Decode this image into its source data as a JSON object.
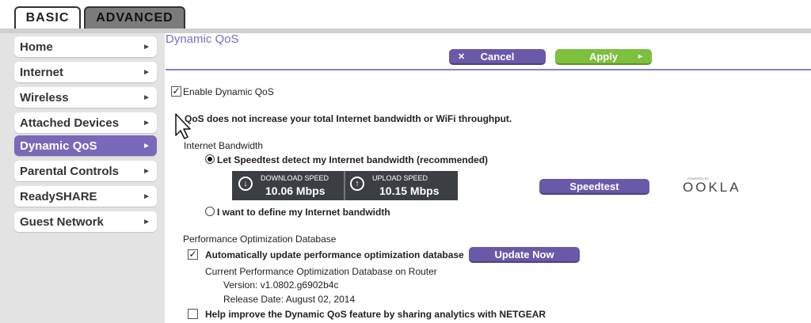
{
  "tabs": {
    "basic": "BASIC",
    "advanced": "ADVANCED"
  },
  "sidebar": {
    "items": [
      {
        "label": "Home"
      },
      {
        "label": "Internet"
      },
      {
        "label": "Wireless"
      },
      {
        "label": "Attached Devices"
      },
      {
        "label": "Dynamic QoS",
        "active": true
      },
      {
        "label": "Parental Controls"
      },
      {
        "label": "ReadySHARE"
      },
      {
        "label": "Guest Network"
      }
    ]
  },
  "page": {
    "title": "Dynamic QoS"
  },
  "actions": {
    "cancel": "Cancel",
    "apply": "Apply"
  },
  "qos": {
    "enable_label": "Enable Dynamic QoS",
    "enable_checked": true,
    "notice": "QoS does not increase your total Internet bandwidth or WiFi throughput."
  },
  "bandwidth": {
    "heading": "Internet Bandwidth",
    "option_auto": "Let Speedtest detect my Internet bandwidth (recommended)",
    "option_manual": "I want to define my Internet bandwidth",
    "selected": "auto",
    "download_label": "DOWNLOAD SPEED",
    "download_value": "10.06 Mbps",
    "upload_label": "UPLOAD SPEED",
    "upload_value": "10.15 Mbps",
    "speedtest_button": "Speedtest",
    "provider_tagline": "POWERED BY",
    "provider": "OOKLA"
  },
  "database": {
    "heading": "Performance Optimization Database",
    "auto_update_label": "Automatically update performance optimization database",
    "auto_update_checked": true,
    "update_button": "Update Now",
    "current_label": "Current Performance Optimization Database on Router",
    "version": "Version: v1.0802.g6902b4c",
    "release_date": "Release Date: August 02, 2014"
  },
  "analytics": {
    "label": "Help improve the Dynamic QoS feature by sharing analytics with NETGEAR",
    "checked": false
  },
  "colors": {
    "accent_purple": "#7a68b8",
    "apply_green": "#7dbf3f",
    "title_purple": "#7b6cc4"
  },
  "icons": [
    "caret-right-icon",
    "close-icon",
    "download-arrow-icon",
    "upload-arrow-icon",
    "mouse-cursor-icon"
  ]
}
